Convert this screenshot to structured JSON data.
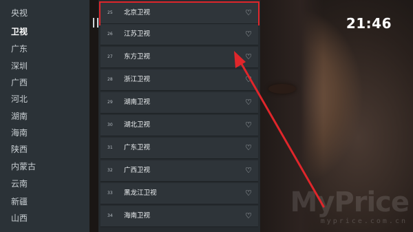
{
  "clock": "21:46",
  "watermark": {
    "brand": "MyPrice",
    "url": "myprice.com.cn"
  },
  "colors": {
    "highlight": "#e0262b",
    "arrow": "#e0262b"
  },
  "provinces": [
    {
      "label": "央视",
      "active": false
    },
    {
      "label": "卫视",
      "active": true
    },
    {
      "label": "广东",
      "active": false
    },
    {
      "label": "深圳",
      "active": false
    },
    {
      "label": "广西",
      "active": false
    },
    {
      "label": "河北",
      "active": false
    },
    {
      "label": "湖南",
      "active": false
    },
    {
      "label": "海南",
      "active": false
    },
    {
      "label": "陕西",
      "active": false
    },
    {
      "label": "内蒙古",
      "active": false
    },
    {
      "label": "云南",
      "active": false
    },
    {
      "label": "新疆",
      "active": false
    },
    {
      "label": "山西",
      "active": false
    }
  ],
  "channels": [
    {
      "num": "25",
      "name": "北京卫视",
      "icon": "heart-outline-icon",
      "highlighted": true
    },
    {
      "num": "26",
      "name": "江苏卫视",
      "icon": "heart-outline-icon",
      "highlighted": false
    },
    {
      "num": "27",
      "name": "东方卫视",
      "icon": "heart-outline-icon",
      "highlighted": false
    },
    {
      "num": "28",
      "name": "浙江卫视",
      "icon": "heart-outline-icon",
      "highlighted": false
    },
    {
      "num": "29",
      "name": "湖南卫视",
      "icon": "heart-outline-icon",
      "highlighted": false
    },
    {
      "num": "30",
      "name": "湖北卫视",
      "icon": "heart-outline-icon",
      "highlighted": false
    },
    {
      "num": "31",
      "name": "广东卫视",
      "icon": "heart-outline-icon",
      "highlighted": false
    },
    {
      "num": "32",
      "name": "广西卫视",
      "icon": "heart-outline-icon",
      "highlighted": false
    },
    {
      "num": "33",
      "name": "黑龙江卫视",
      "icon": "heart-outline-icon",
      "highlighted": false
    },
    {
      "num": "34",
      "name": "海南卫视",
      "icon": "heart-outline-icon",
      "highlighted": false
    }
  ]
}
